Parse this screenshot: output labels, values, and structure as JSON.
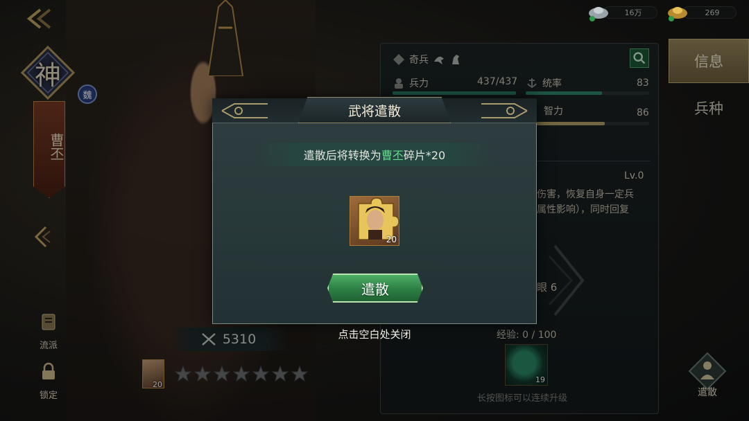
{
  "top": {
    "currencies": [
      {
        "icon": "silver-ingot-icon",
        "value": "16万"
      },
      {
        "icon": "gold-ingot-icon",
        "value": "269"
      }
    ]
  },
  "hero": {
    "rank_char": "神",
    "faction": "魏",
    "name": "曹丕",
    "power": "5310",
    "portrait_level": "20",
    "stars_total": 7
  },
  "side_buttons": {
    "liupai": "流派",
    "suoding": "锁定"
  },
  "stats": {
    "qibing_label": "奇兵",
    "bingli_label": "兵力",
    "bingli_value": "437/437",
    "bingli_fraction": 1.0,
    "tongshuai_label": "统率",
    "tongshuai_value": "83",
    "tongshuai_fraction": 0.62,
    "zhili_label": "智力",
    "zhili_value": "86",
    "zhili_fraction": 0.64
  },
  "skill": {
    "level": "Lv.0",
    "desc_lines": [
      "伤害，恢复自身一定兵",
      "属性影响），同时回复"
    ],
    "partial_label": "眼 6"
  },
  "exp": {
    "text": "经验: 0 / 100",
    "item_count": "19",
    "hint": "长按图标可以连续升级"
  },
  "tabs": {
    "info": "信息",
    "bingzhong": "兵种"
  },
  "dismiss_side_label": "遣散",
  "modal": {
    "title": "武将遣散",
    "msg_prefix": "遣散后将转换为",
    "msg_highlight": "曹丕",
    "msg_suffix": "碎片*20",
    "fragment_count": "20",
    "confirm_label": "遣散",
    "close_hint": "点击空白处关闭"
  },
  "colors": {
    "highlight_green": "#62e08a",
    "bar_hp": "#2f8a73",
    "bar_zhili": "#b8a36a"
  }
}
